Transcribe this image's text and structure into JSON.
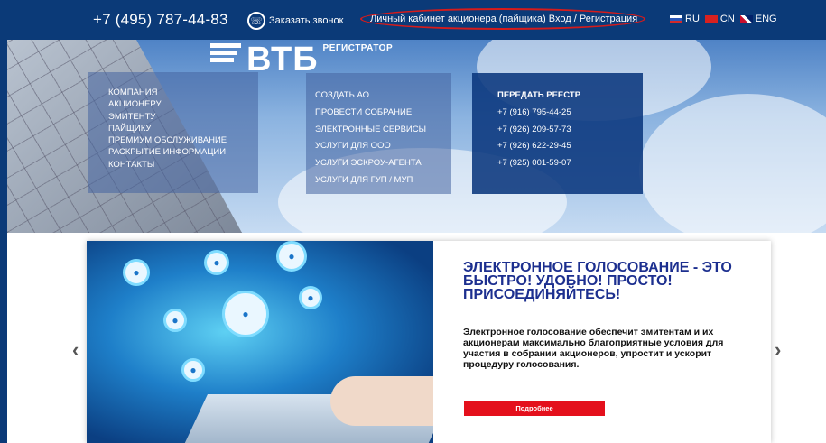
{
  "topbar": {
    "phone": "+7 (495) 787-44-83",
    "callback_label": "Заказать звонок",
    "cabinet_text": "Личный кабинет акционера (пайщика)",
    "login_link": "Вход",
    "separator": "/",
    "register_link": "Регистрация",
    "languages": [
      "RU",
      "CN",
      "ENG"
    ]
  },
  "logo": {
    "main": "ВТБ",
    "sub": "РЕГИСТРАТОР"
  },
  "menu": {
    "col1": [
      "КОМПАНИЯ",
      "АКЦИОНЕРУ",
      "ЭМИТЕНТУ",
      "ПАЙЩИКУ",
      "ПРЕМИУМ ОБСЛУЖИВАНИЕ",
      "РАСКРЫТИЕ ИНФОРМАЦИИ",
      "КОНТАКТЫ"
    ],
    "col2": [
      "СОЗДАТЬ АО",
      "ПРОВЕСТИ СОБРАНИЕ",
      "ЭЛЕКТРОННЫЕ СЕРВИСЫ",
      "УСЛУГИ ДЛЯ ООО",
      "УСЛУГИ ЭСКРОУ-АГЕНТА",
      "УСЛУГИ ДЛЯ ГУП / МУП"
    ],
    "col3": {
      "heading": "ПЕРЕДАТЬ РЕЕСТР",
      "phones": [
        "+7 (916) 795-44-25",
        "+7 (926) 209-57-73",
        "+7 (926) 622-29-45",
        "+7 (925) 001-59-07"
      ]
    }
  },
  "slide": {
    "title": "Электронное голосование - это быстро! Удобно! Просто! Присоединяйтесь!",
    "text": "Электронное голосование обеспечит эмитентам и их акционерам максимально благоприятные условия для участия в собрании акционеров, упростит и ускорит процедуру голосования.",
    "button": "Подробнее"
  },
  "arrows": {
    "prev": "‹",
    "next": "›"
  },
  "colors": {
    "brand_blue": "#0b3a78",
    "accent_red": "#e4101c",
    "title_blue": "#1c2f8f"
  }
}
